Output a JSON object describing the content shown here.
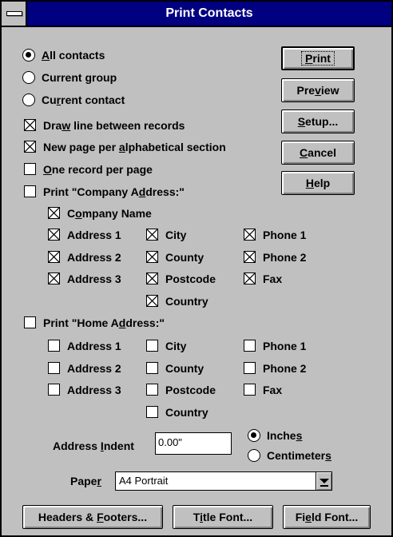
{
  "window": {
    "title": "Print Contacts"
  },
  "scope": {
    "options": [
      {
        "pre": "",
        "key": "A",
        "post": "ll contacts",
        "selected": true
      },
      {
        "pre": "Current ",
        "key": "g",
        "post": "roup",
        "selected": false
      },
      {
        "pre": "Cu",
        "key": "r",
        "post": "rent contact",
        "selected": false
      }
    ]
  },
  "options": {
    "draw_line": {
      "pre": "Dra",
      "key": "w",
      "post": " line between records",
      "checked": true
    },
    "new_page": {
      "pre": "New page per ",
      "key": "a",
      "post": "lphabetical section",
      "checked": true
    },
    "one_record": {
      "pre": "",
      "key": "O",
      "post": "ne record per page",
      "checked": false
    }
  },
  "company": {
    "print": {
      "pre": "Print \"Company A",
      "key": "d",
      "post": "dress:\"",
      "checked": false
    },
    "name": {
      "pre": "C",
      "key": "o",
      "post": "mpany Name",
      "checked": true
    },
    "fields": {
      "address1": {
        "label": "Address 1",
        "checked": true
      },
      "address2": {
        "label": "Address 2",
        "checked": true
      },
      "address3": {
        "label": "Address 3",
        "checked": true
      },
      "city": {
        "label": "City",
        "checked": true
      },
      "county": {
        "label": "County",
        "checked": true
      },
      "postcode": {
        "label": "Postcode",
        "checked": true
      },
      "country": {
        "label": "Country",
        "checked": true
      },
      "phone1": {
        "label": "Phone 1",
        "checked": true
      },
      "phone2": {
        "label": "Phone 2",
        "checked": true
      },
      "fax": {
        "label": "Fax",
        "checked": true
      }
    }
  },
  "home": {
    "print": {
      "pre": "Print \"Home A",
      "key": "d",
      "post": "dress:\"",
      "checked": false
    },
    "fields": {
      "address1": {
        "label": "Address 1",
        "checked": false
      },
      "address2": {
        "label": "Address 2",
        "checked": false
      },
      "address3": {
        "label": "Address 3",
        "checked": false
      },
      "city": {
        "label": "City",
        "checked": false
      },
      "county": {
        "label": "County",
        "checked": false
      },
      "postcode": {
        "label": "Postcode",
        "checked": false
      },
      "country": {
        "label": "Country",
        "checked": false
      },
      "phone1": {
        "label": "Phone 1",
        "checked": false
      },
      "phone2": {
        "label": "Phone 2",
        "checked": false
      },
      "fax": {
        "label": "Fax",
        "checked": false
      }
    }
  },
  "indent": {
    "label_pre": "Address ",
    "label_key": "I",
    "label_post": "ndent",
    "value": "0.00\"",
    "units": [
      {
        "pre": "Inche",
        "key": "s",
        "post": "",
        "selected": true
      },
      {
        "pre": "Centimeter",
        "key": "s",
        "post": "",
        "selected": false
      }
    ]
  },
  "paper": {
    "label_pre": "Pape",
    "label_key": "r",
    "label_post": "",
    "value": "A4 Portrait"
  },
  "buttons": {
    "print": {
      "pre": "",
      "key": "P",
      "post": "rint"
    },
    "preview": {
      "pre": "Pre",
      "key": "v",
      "post": "iew"
    },
    "setup": {
      "pre": "",
      "key": "S",
      "post": "etup..."
    },
    "cancel": {
      "pre": "",
      "key": "C",
      "post": "ancel"
    },
    "help": {
      "pre": "",
      "key": "H",
      "post": "elp"
    },
    "headers": {
      "pre": "Headers & ",
      "key": "F",
      "post": "ooters..."
    },
    "title_font": {
      "pre": "T",
      "key": "i",
      "post": "tle Font..."
    },
    "field_font": {
      "pre": "Fi",
      "key": "e",
      "post": "ld Font..."
    }
  }
}
